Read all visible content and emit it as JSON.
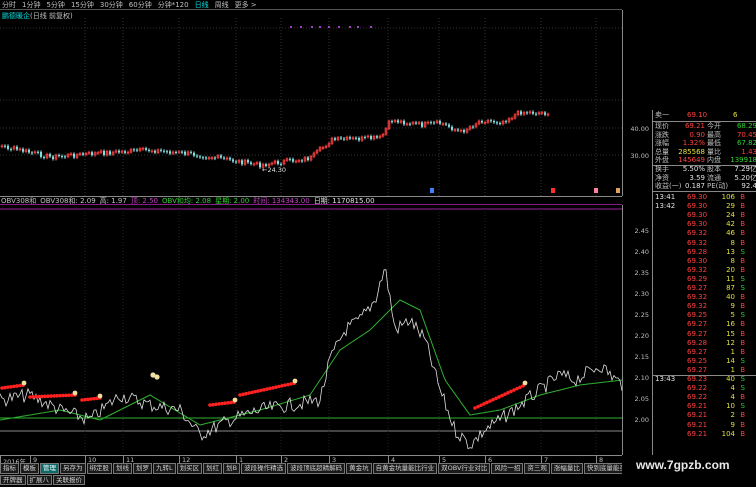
{
  "period_bar": [
    "分时",
    "1分钟",
    "5分钟",
    "15分钟",
    "30分钟",
    "60分钟",
    "分钟*120",
    "日线",
    "周线",
    "更多 >"
  ],
  "active_period": "日线",
  "chart_title": {
    "name": "鹏德暖企",
    "suffix": "(日线 前复权)"
  },
  "price_axis": [
    "40.00",
    "30.00"
  ],
  "low_label": "←24.30",
  "indicator_header": [
    {
      "text": "OBV308和",
      "color": "#c0c0c0"
    },
    {
      "text": "OBV308和: 2.09",
      "color": "#c0c0c0"
    },
    {
      "text": "高: 1.97",
      "color": "#c0c0c0"
    },
    {
      "text": "顶: 2.50",
      "color": "#c040c0"
    },
    {
      "text": "OBV和均: 2.08",
      "color": "#30d030"
    },
    {
      "text": "星期: 2.00",
      "color": "#30d030"
    },
    {
      "text": "时间: 134343.00",
      "color": "#c040c0"
    },
    {
      "text": "日期: 1170815.00",
      "color": "#e0e0e0"
    }
  ],
  "indicator_axis": [
    "2.45",
    "2.40",
    "2.35",
    "2.30",
    "2.25",
    "2.20",
    "2.15",
    "2.10",
    "2.05",
    "2.00"
  ],
  "quote": {
    "sell1": {
      "label": "卖一",
      "price": "69.10",
      "vol": "6"
    },
    "rows": [
      {
        "l1": "现价",
        "v1": "69.21",
        "c1": "red",
        "l2": "今开",
        "v2": "68.29",
        "c2": "green"
      },
      {
        "l1": "涨跌",
        "v1": "0.90",
        "c1": "red",
        "l2": "最高",
        "v2": "70.45",
        "c2": "red"
      },
      {
        "l1": "涨幅",
        "v1": "1.32%",
        "c1": "red",
        "l2": "最低",
        "v2": "67.82",
        "c2": "green"
      },
      {
        "l1": "总量",
        "v1": "285568",
        "c1": "yellow",
        "l2": "量比",
        "v2": "1.43",
        "c2": "red"
      },
      {
        "l1": "外盘",
        "v1": "145649",
        "c1": "red",
        "l2": "内盘",
        "v2": "139918",
        "c2": "green"
      },
      {
        "l1": "换手",
        "v1": "5.50%",
        "c1": "white",
        "l2": "股本",
        "v2": "7.29亿",
        "c2": "white"
      },
      {
        "l1": "净资",
        "v1": "3.59",
        "c1": "white",
        "l2": "流通",
        "v2": "5.20亿",
        "c2": "white"
      },
      {
        "l1": "收益(一)",
        "v1": "0.187",
        "c1": "white",
        "l2": "PE(动)",
        "v2": "92.4",
        "c2": "white"
      }
    ]
  },
  "ticks": [
    {
      "t": "13:41",
      "p": "69.30",
      "v": "106",
      "s": "B"
    },
    {
      "t": "13:42",
      "p": "69.30",
      "v": "29",
      "s": "B"
    },
    {
      "t": "",
      "p": "69.30",
      "v": "24",
      "s": "B"
    },
    {
      "t": "",
      "p": "69.30",
      "v": "42",
      "s": "B"
    },
    {
      "t": "",
      "p": "69.32",
      "v": "46",
      "s": "B"
    },
    {
      "t": "",
      "p": "69.32",
      "v": "8",
      "s": "B"
    },
    {
      "t": "",
      "p": "69.28",
      "v": "13",
      "s": "S"
    },
    {
      "t": "",
      "p": "69.30",
      "v": "8",
      "s": "B"
    },
    {
      "t": "",
      "p": "69.32",
      "v": "20",
      "s": "B"
    },
    {
      "t": "",
      "p": "69.29",
      "v": "11",
      "s": "S"
    },
    {
      "t": "",
      "p": "69.27",
      "v": "87",
      "s": "S"
    },
    {
      "t": "",
      "p": "69.32",
      "v": "40",
      "s": "B"
    },
    {
      "t": "",
      "p": "69.32",
      "v": "9",
      "s": "B"
    },
    {
      "t": "",
      "p": "69.25",
      "v": "5",
      "s": "S"
    },
    {
      "t": "",
      "p": "69.27",
      "v": "16",
      "s": "B"
    },
    {
      "t": "",
      "p": "69.27",
      "v": "15",
      "s": "B"
    },
    {
      "t": "",
      "p": "69.28",
      "v": "12",
      "s": "B"
    },
    {
      "t": "",
      "p": "69.27",
      "v": "1",
      "s": "B"
    },
    {
      "t": "",
      "p": "69.25",
      "v": "14",
      "s": "S"
    },
    {
      "t": "",
      "p": "69.27",
      "v": "1",
      "s": "B"
    },
    {
      "t": "13:43",
      "p": "69.23",
      "v": "40",
      "s": "S"
    },
    {
      "t": "",
      "p": "69.22",
      "v": "4",
      "s": "S"
    },
    {
      "t": "",
      "p": "69.22",
      "v": "4",
      "s": "B"
    },
    {
      "t": "",
      "p": "69.21",
      "v": "10",
      "s": "S"
    },
    {
      "t": "",
      "p": "69.21",
      "v": "2",
      "s": "B"
    },
    {
      "t": "",
      "p": "69.21",
      "v": "9",
      "s": "B"
    },
    {
      "t": "",
      "p": "69.21",
      "v": "104",
      "s": "B"
    }
  ],
  "date_axis": [
    "2016年",
    "9",
    "10",
    "11",
    "12",
    "1",
    "2",
    "3",
    "4",
    "5",
    "6",
    "7",
    "8"
  ],
  "tabs_row1": [
    "指标",
    "模板",
    "管理",
    "另存为",
    "绑定股",
    "划线",
    "划罗",
    "九转L",
    "划买区",
    "划红",
    "划B",
    "波段操作精选",
    "波段顶底超精解码",
    "黄金坑",
    "自黄金坑量能比行业",
    "双OBV行业对比",
    "风险一招",
    "资三观",
    "涨幅量比",
    "快到底量能买卖红",
    "四维阴阳",
    "主力吃货",
    "波动深跌量潜VOL买卖",
    "划粉"
  ],
  "active_tab": "管理",
  "tabs_row2": [
    "开牌器",
    "扩展八",
    "关联报价"
  ],
  "watermark": "www.7gpzb.com",
  "colors": {
    "up": "#ff4040",
    "down": "#80e0e0",
    "obv": "#e0e0e0",
    "obv_ma": "#30b030",
    "accent": "#00e0e0"
  }
}
